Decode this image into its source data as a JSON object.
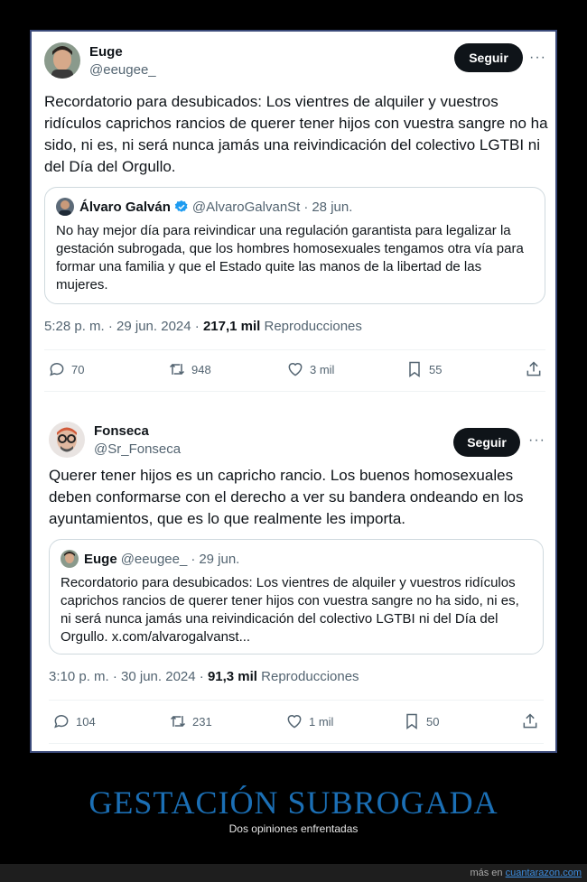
{
  "tweet1": {
    "name": "Euge",
    "handle": "@eeugee_",
    "follow_label": "Seguir",
    "more_label": "···",
    "text": "Recordatorio para desubicados: Los vientres de alquiler y vuestros ridículos caprichos rancios de querer tener hijos con vuestra sangre no ha sido, ni es, ni será nunca jamás una reivindicación del colectivo LGTBI ni del Día del Orgullo.",
    "quote": {
      "name": "Álvaro Galván",
      "handle": "@AlvaroGalvanSt",
      "date": "28 jun.",
      "text": "No hay mejor día para reivindicar una regulación garantista para legalizar la gestación subrogada, que los hombres homosexuales tengamos otra vía para formar una familia y que el Estado quite las manos de la libertad de las mujeres."
    },
    "time": "5:28 p. m. · 29 jun. 2024 · ",
    "views": "217,1 mil",
    "views_label": " Reproducciones",
    "replies": "70",
    "retweets": "948",
    "likes": "3 mil",
    "bookmarks": "55"
  },
  "tweet2": {
    "name": "Fonseca",
    "handle": "@Sr_Fonseca",
    "follow_label": "Seguir",
    "more_label": "···",
    "text": "Querer tener hijos es un capricho rancio. Los buenos homosexuales deben conformarse con el derecho a ver su bandera ondeando en los ayuntamientos, que es lo que realmente les importa.",
    "quote": {
      "name": "Euge",
      "handle": "@eeugee_",
      "date": "29 jun.",
      "text": "Recordatorio para desubicados: Los vientres de alquiler y vuestros ridículos caprichos rancios de querer tener hijos con vuestra sangre no ha sido, ni es, ni será nunca jamás una reivindicación del colectivo LGTBI ni del Día del Orgullo. x.com/alvarogalvanst..."
    },
    "time": "3:10 p. m. · 30 jun. 2024 · ",
    "views": "91,3 mil",
    "views_label": " Reproducciones",
    "replies": "104",
    "retweets": "231",
    "likes": "1 mil",
    "bookmarks": "50"
  },
  "caption": {
    "title": "GESTACIÓN SUBROGADA",
    "subtitle": "Dos opiniones enfrentadas"
  },
  "footer": {
    "prefix": "más en ",
    "link": "cuantarazon.com"
  },
  "colors": {
    "title_blue": "#1b6fb5",
    "verified_blue": "#1d9bf0",
    "link_blue": "#3d8ee0"
  }
}
